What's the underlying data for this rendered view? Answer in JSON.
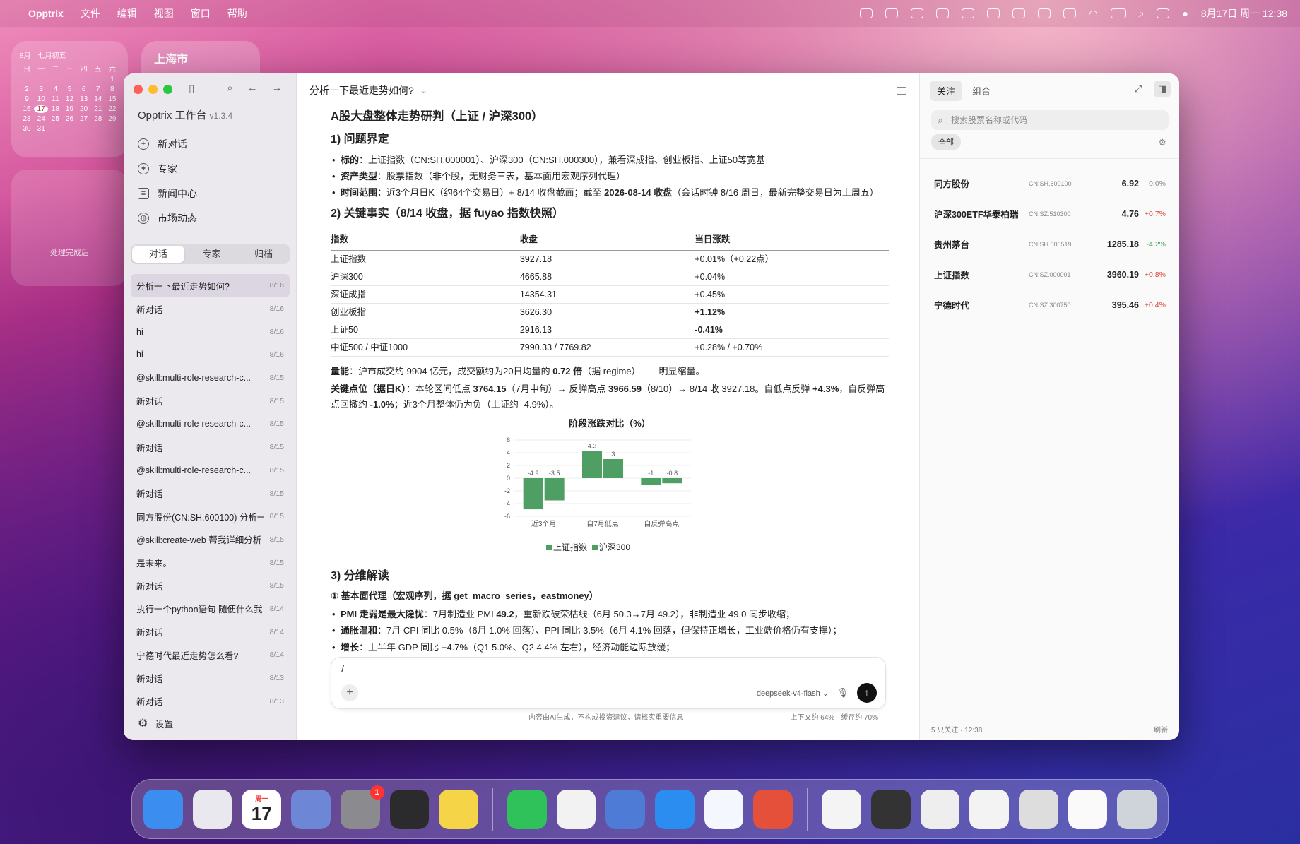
{
  "menubar": {
    "app": "Opptrix",
    "items": [
      "文件",
      "编辑",
      "视图",
      "窗口",
      "帮助"
    ],
    "datetime": "8月17日 周一 12:38"
  },
  "widgets": {
    "calendar": {
      "month": "8月",
      "lunar": "七月初五",
      "weekdays": [
        "日",
        "一",
        "二",
        "三",
        "四",
        "五",
        "六"
      ],
      "days": [
        "",
        "",
        "",
        "",
        "",
        "",
        "1",
        "2",
        "3",
        "4",
        "5",
        "6",
        "7",
        "8",
        "9",
        "10",
        "11",
        "12",
        "13",
        "14",
        "15",
        "16",
        "17",
        "18",
        "19",
        "20",
        "21",
        "22",
        "23",
        "24",
        "25",
        "26",
        "27",
        "28",
        "29",
        "30",
        "31"
      ],
      "today": "17"
    },
    "weather": {
      "city": "上海市"
    },
    "big": {
      "text": "处理完成后"
    }
  },
  "sidebar": {
    "title": "Opptrix 工作台",
    "version": "v1.3.4",
    "nav": [
      {
        "label": "新对话",
        "icon": "plus-icon"
      },
      {
        "label": "专家",
        "icon": "expert-icon"
      },
      {
        "label": "新闻中心",
        "icon": "news-icon"
      },
      {
        "label": "市场动态",
        "icon": "globe-icon"
      }
    ],
    "tabs": [
      "对话",
      "专家",
      "归档"
    ],
    "conversations": [
      {
        "title": "分析一下最近走势如何?",
        "date": "8/16"
      },
      {
        "title": "新对话",
        "date": "8/16"
      },
      {
        "title": "hi",
        "date": "8/16"
      },
      {
        "title": "hi",
        "date": "8/16"
      },
      {
        "title": "@skill:multi-role-research-c...",
        "date": "8/15"
      },
      {
        "title": "新对话",
        "date": "8/15"
      },
      {
        "title": "@skill:multi-role-research-c...",
        "date": "8/15"
      },
      {
        "title": "新对话",
        "date": "8/15"
      },
      {
        "title": "@skill:multi-role-research-c...",
        "date": "8/15"
      },
      {
        "title": "新对话",
        "date": "8/15"
      },
      {
        "title": "同方股份(CN:SH.600100) 分析一",
        "date": "8/15"
      },
      {
        "title": "@skill:create-web 帮我详细分析",
        "date": "8/15"
      },
      {
        "title": "是未来。",
        "date": "8/15"
      },
      {
        "title": "新对话",
        "date": "8/15"
      },
      {
        "title": "执行一个python语句 随便什么我",
        "date": "8/14"
      },
      {
        "title": "新对话",
        "date": "8/14"
      },
      {
        "title": "宁德时代最近走势怎么看?",
        "date": "8/14"
      },
      {
        "title": "新对话",
        "date": "8/13"
      },
      {
        "title": "新对话",
        "date": "8/13"
      }
    ],
    "settings": "设置"
  },
  "main": {
    "title": "分析一下最近走势如何?",
    "heading": "A股大盘整体走势研判（上证 / 沪深300）",
    "s1": {
      "title": "1) 问题界定",
      "items": [
        {
          "k": "标的",
          "v": "：上证指数（CN:SH.000001）、沪深300（CN:SH.000300），兼看深成指、创业板指、上证50等宽基"
        },
        {
          "k": "资产类型",
          "v": "：股票指数（非个股，无财务三表，基本面用宏观序列代理）"
        },
        {
          "k": "时间范围",
          "v": "：近3个月日K（约64个交易日）+ 8/14 收盘截面；截至 ",
          "b2": "2026-08-14 收盘",
          "v2": "（会话时钟 8/16 周日，最新完整交易日为上周五）"
        }
      ]
    },
    "s2": {
      "title": "2) 关键事实（8/14 收盘，据 fuyao 指数快照）",
      "headers": [
        "指数",
        "收盘",
        "当日涨跌"
      ],
      "rows": [
        [
          "上证指数",
          "3927.18",
          "+0.01%（+0.22点）"
        ],
        [
          "沪深300",
          "4665.88",
          "+0.04%"
        ],
        [
          "深证成指",
          "14354.31",
          "+0.45%"
        ],
        [
          "创业板指",
          "3626.30",
          "+1.12%"
        ],
        [
          "上证50",
          "2916.13",
          "-0.41%"
        ],
        [
          "中证500 / 中证1000",
          "7990.33 / 7769.82",
          "+0.28% / +0.70%"
        ]
      ],
      "bold_rows": [
        3,
        4
      ],
      "volume": {
        "k": "量能",
        "v": "：沪市成交约 9904 亿元，成交额约为20日均量的 ",
        "b": "0.72 倍",
        "v2": "（据 regime）——明显缩量。"
      },
      "levels": {
        "k": "关键点位（据日K）",
        "v": "：本轮区间低点 ",
        "b1": "3764.15",
        "v1": "（7月中旬）→ 反弹高点 ",
        "b2": "3966.59",
        "v2": "（8/10）→ 8/14 收 3927.18。自低点反弹 ",
        "b3": "+4.3%",
        "v3": "，自反弹高点回撤约 ",
        "b4": "-1.0%",
        "v4": "；近3个月整体仍为负（上证约 -4.9%）。"
      }
    },
    "s3": {
      "title": "3) 分维解读",
      "sub": "① 基本面代理（宏观序列，据 get_macro_series，eastmoney）",
      "items": [
        {
          "k": "PMI 走弱是最大隐忧",
          "v": "：7月制造业 PMI ",
          "b": "49.2",
          "v2": "，重新跌破荣枯线（6月 50.3→7月 49.2），非制造业 49.0 同步收缩；"
        },
        {
          "k": "通胀温和",
          "v": "：7月 CPI 同比 0.5%（6月 1.0% 回落）、PPI 同比 3.5%（6月 4.1% 回落，但保持正增长，工业端价格仍有支撑）；",
          "b": "",
          "v2": ""
        },
        {
          "k": "增长",
          "v": "：上半年 GDP 同比 +4.7%（Q1 5.0%、Q2 4.4% 左右），经济动能边际放缓；",
          "b": "",
          "v2": ""
        }
      ]
    },
    "input": {
      "value": "/",
      "model": "deepseek-v4-flash"
    },
    "footer": {
      "center": "内容由AI生成，不构成投资建议，请核实重要信息",
      "right": "上下文约 64% · 缓存约 70%"
    }
  },
  "chart_data": {
    "type": "bar",
    "title": "阶段涨跌对比（%）",
    "categories": [
      "近3个月",
      "自7月低点",
      "自反弹高点"
    ],
    "series": [
      {
        "name": "上证指数",
        "values": [
          -4.9,
          4.3,
          -1
        ]
      },
      {
        "name": "沪深300",
        "values": [
          -3.5,
          3,
          -0.8
        ]
      }
    ],
    "ylim": [
      -6,
      6
    ],
    "yticks": [
      6,
      4,
      2,
      0,
      -2,
      -4,
      -6
    ],
    "color": "#4f9e64",
    "legend": "bottom",
    "grid": true
  },
  "right": {
    "tabs": [
      "关注",
      "组合"
    ],
    "search_placeholder": "搜索股票名称或代码",
    "filter": "全部",
    "stocks": [
      {
        "name": "同方股份",
        "code": "CN:SH.600100",
        "price": "6.92",
        "change": "0.0%",
        "dir": "flat"
      },
      {
        "name": "沪深300ETF华泰柏瑞",
        "code": "CN:SZ.510300",
        "price": "4.76",
        "change": "+0.7%",
        "dir": "up"
      },
      {
        "name": "贵州茅台",
        "code": "CN:SH.600519",
        "price": "1285.18",
        "change": "-4.2%",
        "dir": "down"
      },
      {
        "name": "上证指数",
        "code": "CN:SZ.000001",
        "price": "3960.19",
        "change": "+0.8%",
        "dir": "up"
      },
      {
        "name": "宁德时代",
        "code": "CN:SZ.300750",
        "price": "395.46",
        "change": "+0.4%",
        "dir": "up"
      }
    ],
    "footer_left": "5 只关注 · 12:38",
    "footer_right": "刷新"
  },
  "dock": {
    "apps": [
      {
        "name": "finder",
        "color": "#3b8ef0"
      },
      {
        "name": "launchpad",
        "color": "#e8e8ee"
      },
      {
        "name": "calendar",
        "color": "#ffffff",
        "label": "17",
        "sub": "周一"
      },
      {
        "name": "files",
        "color": "#6d86d6"
      },
      {
        "name": "system-settings",
        "color": "#8a8a8f",
        "badge": "1"
      },
      {
        "name": "terminal",
        "color": "#2b2b2e"
      },
      {
        "name": "notes",
        "color": "#f5d547"
      }
    ],
    "apps2": [
      {
        "name": "wechat",
        "color": "#2fc15a"
      },
      {
        "name": "chrome",
        "color": "#f2f2f2"
      },
      {
        "name": "opptrix-app",
        "color": "#4d7bd6"
      },
      {
        "name": "safari",
        "color": "#2b8df0"
      },
      {
        "name": "cloud",
        "color": "#f5f7ff"
      },
      {
        "name": "stocks-app",
        "color": "#e4503a"
      }
    ],
    "apps3": [
      {
        "name": "document",
        "color": "#f4f4f4"
      },
      {
        "name": "window-thumb-1",
        "color": "#333"
      },
      {
        "name": "window-thumb-2",
        "color": "#eee"
      },
      {
        "name": "window-thumb-3",
        "color": "#f3f3f3"
      },
      {
        "name": "window-thumb-4",
        "color": "#ddd"
      },
      {
        "name": "window-thumb-5",
        "color": "#fafafa"
      },
      {
        "name": "trash",
        "color": "#cfd4db"
      }
    ]
  }
}
